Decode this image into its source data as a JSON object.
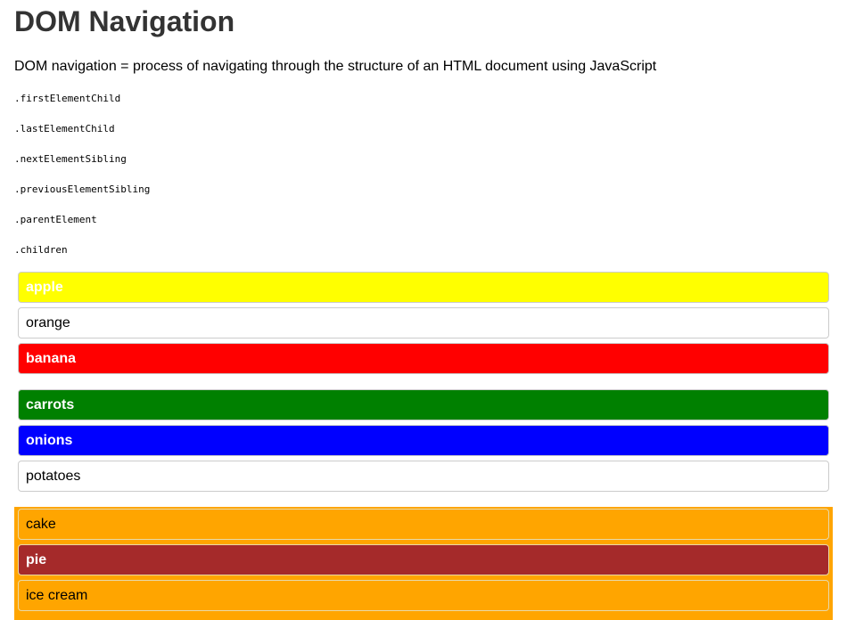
{
  "page": {
    "title": "DOM Navigation",
    "intro": "DOM navigation = process of navigating through the structure of an HTML document using JavaScript"
  },
  "methods": [
    ".firstElementChild",
    ".lastElementChild",
    ".nextElementSibling",
    ".previousElementSibling",
    ".parentElement",
    ".children"
  ],
  "fruits": [
    {
      "label": "apple",
      "bg": "#ffff00",
      "bold": true
    },
    {
      "label": "orange",
      "bg": "#ffffff",
      "bold": false
    },
    {
      "label": "banana",
      "bg": "#ff0000",
      "bold": true
    }
  ],
  "vegetables": [
    {
      "label": "carrots",
      "bg": "#008000",
      "bold": true
    },
    {
      "label": "onions",
      "bg": "#0000ff",
      "bold": true
    },
    {
      "label": "potatoes",
      "bg": "#ffffff",
      "bold": false
    }
  ],
  "desserts": {
    "list_bg": "#ffa500",
    "items": [
      {
        "label": "cake",
        "bg": "#ffa500",
        "bold": false
      },
      {
        "label": "pie",
        "bg": "#a52a2a",
        "bold": true
      },
      {
        "label": "ice cream",
        "bg": "#ffa500",
        "bold": false
      }
    ]
  }
}
